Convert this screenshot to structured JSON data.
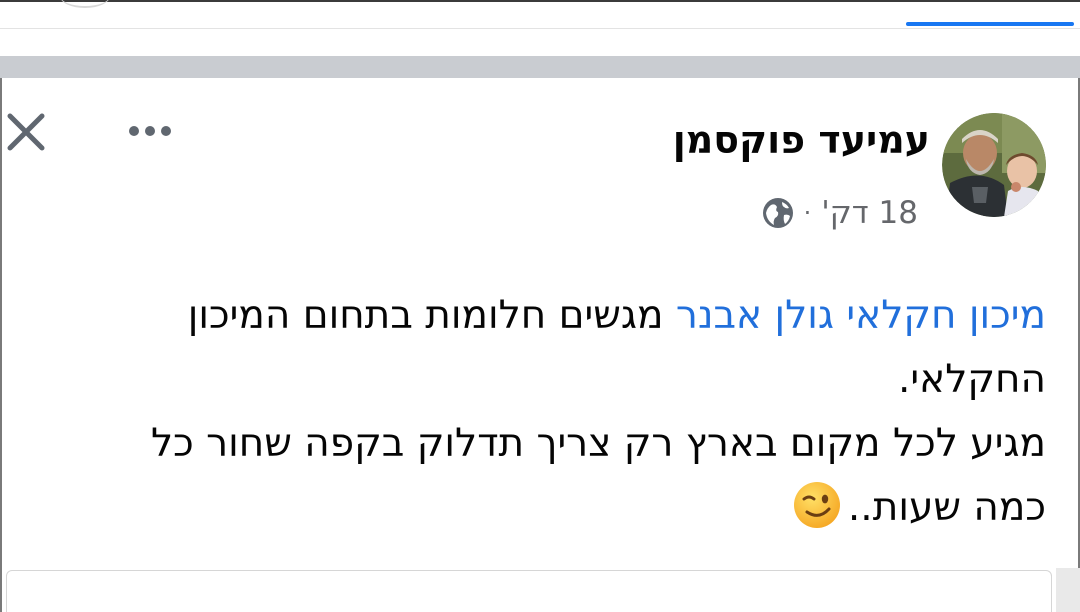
{
  "post": {
    "author_name": "עמיעד פוקסמן",
    "time": "18 דק'",
    "meta_separator": "·",
    "privacy_icon": "globe-icon",
    "mention": "מיכון חקלאי גולן אבנר",
    "line1_rest": " מגשים חלומות בתחום המיכון",
    "line2": "החקלאי.",
    "line3": "מגיע לכל מקום בארץ רק צריך תדלוק בקפה שחור כל",
    "line4": "כמה שעות..",
    "emoji": "winking-face-emoji"
  },
  "header": {
    "close_icon": "close-icon",
    "more_icon": "more-options-icon"
  },
  "colors": {
    "mention": "#216fdb",
    "text": "#050505",
    "meta": "#65676b",
    "separator_band": "#c9ccd1",
    "tab_indicator": "#1877f2"
  }
}
